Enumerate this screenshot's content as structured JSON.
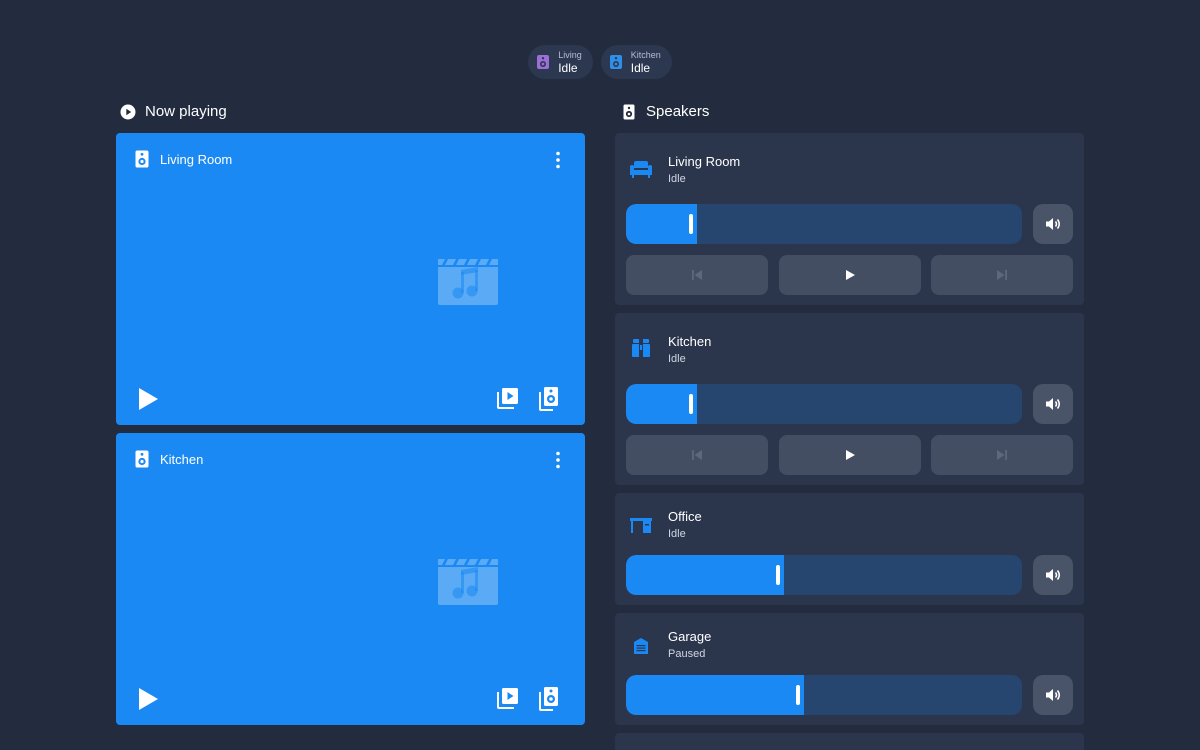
{
  "chips": [
    {
      "name": "Living",
      "state": "Idle",
      "color": "#9b6fd6",
      "icon": "speaker-icon"
    },
    {
      "name": "Kitchen",
      "state": "Idle",
      "color": "#2f8fe8",
      "icon": "speaker-icon"
    }
  ],
  "now_playing": {
    "title": "Now playing",
    "cards": [
      {
        "name": "Living Room",
        "state": "idle"
      },
      {
        "name": "Kitchen",
        "state": "idle"
      }
    ]
  },
  "speakers": {
    "title": "Speakers",
    "items": [
      {
        "name": "Living Room",
        "state": "Idle",
        "icon": "sofa-icon",
        "volume": 0.18,
        "has_controls": true
      },
      {
        "name": "Kitchen",
        "state": "Idle",
        "icon": "fridge-icon",
        "volume": 0.18,
        "has_controls": true
      },
      {
        "name": "Office",
        "state": "Idle",
        "icon": "desk-icon",
        "volume": 0.4,
        "has_controls": false
      },
      {
        "name": "Garage",
        "state": "Paused",
        "icon": "garage-icon",
        "volume": 0.45,
        "has_controls": false
      }
    ]
  },
  "colors": {
    "background": "#232c3e",
    "accent": "#1b89f3",
    "panel": "#2b354c"
  }
}
